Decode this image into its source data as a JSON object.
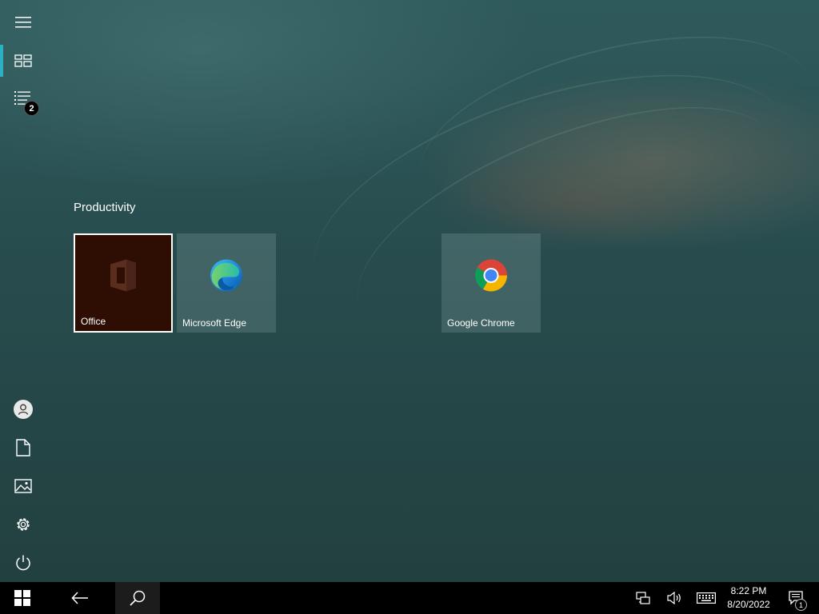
{
  "start": {
    "group_title": "Productivity",
    "tiles": [
      {
        "label": "Office",
        "icon": "office-icon",
        "bg": "#2e0d03"
      },
      {
        "label": "Microsoft Edge",
        "icon": "edge-icon"
      },
      {
        "label": "Google Chrome",
        "icon": "chrome-icon"
      }
    ]
  },
  "rail": {
    "items": [
      {
        "icon": "hamburger-menu-icon"
      },
      {
        "icon": "pinned-tiles-icon",
        "active": true
      },
      {
        "icon": "all-apps-list-icon",
        "badge": "2"
      },
      {
        "icon": "user-account-icon"
      },
      {
        "icon": "documents-icon"
      },
      {
        "icon": "pictures-icon"
      },
      {
        "icon": "settings-gear-icon"
      },
      {
        "icon": "power-icon"
      }
    ],
    "accent": "#2bb0c4"
  },
  "taskbar": {
    "time": "8:22 PM",
    "date": "8/20/2022",
    "notification_count": "1"
  }
}
